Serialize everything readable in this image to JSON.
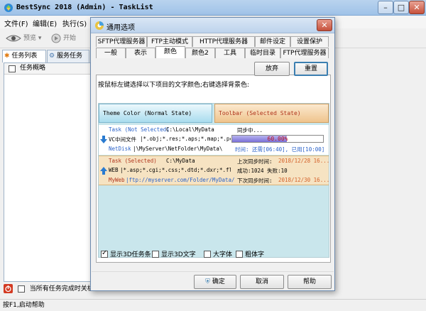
{
  "main": {
    "title": "BestSync 2018 (Admin) - TaskList",
    "menu": [
      "文件(F)",
      "编辑(E)",
      "执行(S)"
    ],
    "toolbar": {
      "preview": "预览",
      "start": "开始"
    },
    "side_tabs": [
      "任务列表",
      "服务任务"
    ],
    "list_header": "任务概略",
    "bottom_option": "当所有任务完成时关机",
    "status": "按F1,启动帮助"
  },
  "dialog": {
    "title": "通用选项",
    "tabs_row1": [
      "SFTP代理服务器",
      "FTP主动模式",
      "HTTP代理服务器",
      "邮件设定",
      "设置保护"
    ],
    "tabs_row2": [
      "一般",
      "表示",
      "颜色",
      "颜色2",
      "工具",
      "临时目录",
      "FTP代理服务器"
    ],
    "active_tab": "颜色",
    "hint": "按鼠标左键选择以下项目的文字颜色;右键选择背景色:",
    "buttons": {
      "discard": "放弃",
      "reset": "重置",
      "ok": "确定",
      "cancel": "取消",
      "help": "帮助"
    },
    "swatches": {
      "normal": "Theme Color (Normal State)",
      "selected": "Toolbar (Selected State)"
    },
    "task1": {
      "name": "Task (Not Selected)",
      "path": "C:\\Local\\MyData",
      "filter": "VC中间文件",
      "filter_ext": "|*.obj;*.res;*.aps;*.map;*.pc...",
      "netdisk": "NetDisk",
      "netdisk_path": "|\\MyServer\\NetFolder\\MyData\\",
      "status": "同步中...",
      "progress_text": "60.00%",
      "progress": 0.6,
      "time": "时间: 还需[06:40], 已用[10:00]"
    },
    "task2": {
      "name": "Task (Selected)",
      "path": "C:\\MyData",
      "filter": "WEB",
      "filter_ext": "|*.asp;*.cgi;*.css;*.dtd;*.dxr;*.fl...",
      "web": "MyWeb",
      "web_path": "|ftp://myserver.com/Folder/MyData/",
      "last_sync_label": "上次同步时间:",
      "last_sync": "2018/12/28 16...",
      "result": "成功:1024 失败:10",
      "next_sync_label": "下次同步时间:",
      "next_sync": "2018/12/30 16..."
    },
    "options": [
      {
        "label": "显示3D任务条",
        "checked": true
      },
      {
        "label": "显示3D文字",
        "checked": false
      },
      {
        "label": "大字体",
        "checked": false
      },
      {
        "label": "粗体字",
        "checked": false
      }
    ]
  },
  "colors": {
    "accent_blue": "#3c7fb1",
    "progress_text": "#c0101a",
    "selected_text": "#b0341c",
    "web_blue": "#2a62c9",
    "date_orange": "#d4612a"
  }
}
